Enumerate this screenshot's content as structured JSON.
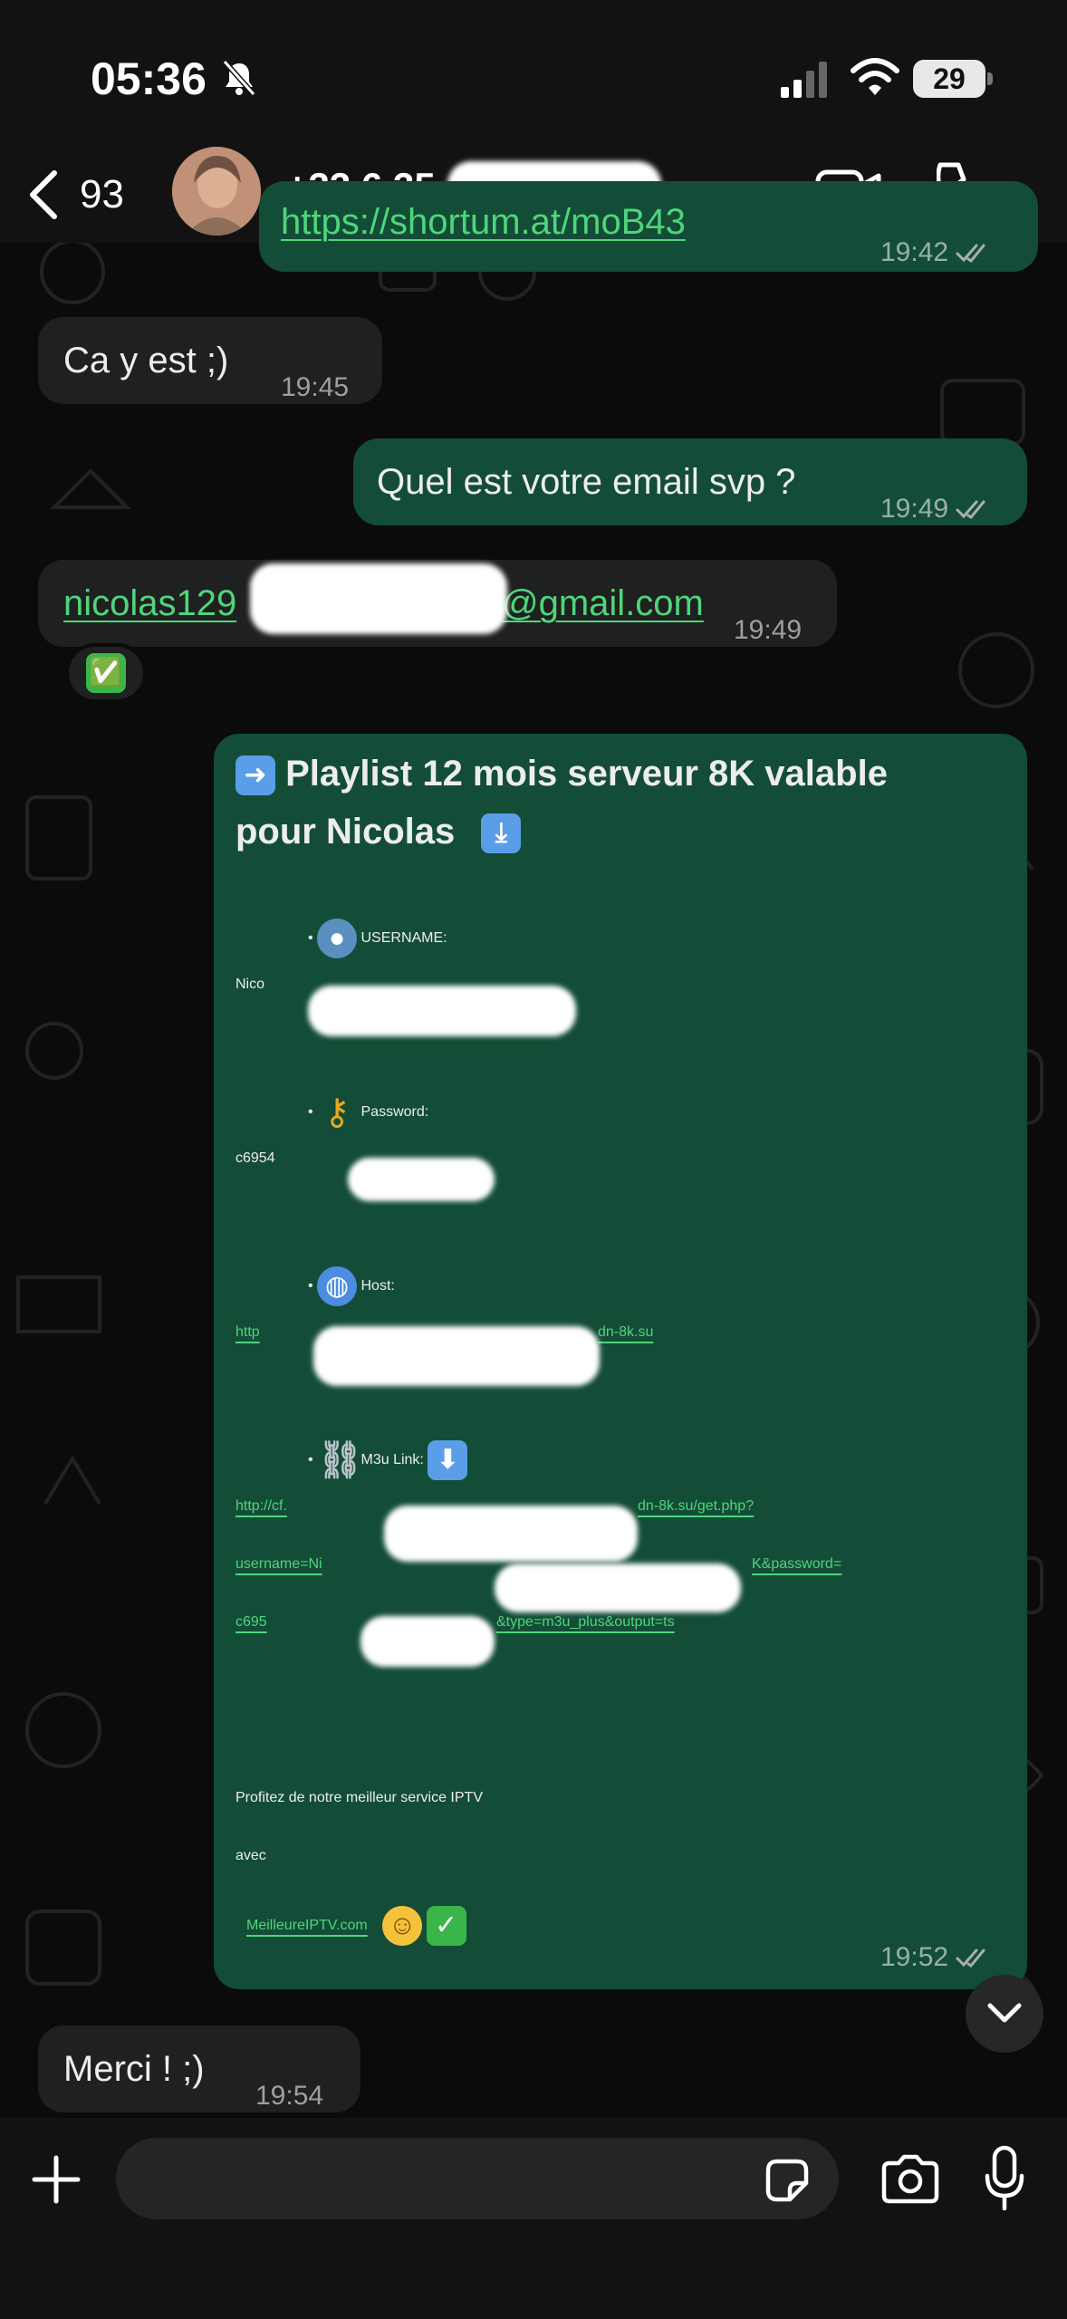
{
  "status_bar": {
    "time": "05:36",
    "battery": "29"
  },
  "header": {
    "back_count": "93",
    "contact_name": "+33 6 35"
  },
  "messages": [
    {
      "dir": "out",
      "text": "https://shortum.at/moB43",
      "time": "19:42"
    },
    {
      "dir": "in",
      "text": "Ca y est ;)",
      "time": "19:45"
    },
    {
      "dir": "out",
      "text": "Quel est votre email svp ?",
      "time": "19:49"
    },
    {
      "dir": "in",
      "text_start": "nicolas129",
      "text_end": "@gmail.com",
      "time": "19:49",
      "reaction": "✅"
    },
    {
      "dir": "out",
      "title_line1": "Playlist 12 mois serveur 8K valable",
      "title_line2": "pour Nicolas",
      "username_label": "USERNAME:",
      "username_value": "Nico",
      "password_label": "Password:",
      "password_value": "c6954",
      "host_label": "Host:",
      "host_start": "http",
      "host_end": "dn-8k.su",
      "m3u_label": "M3u Link:",
      "m3u_line1_start": "http://cf.",
      "m3u_line1_end": "dn-8k.su/get.php?",
      "m3u_line2_start": "username=Ni",
      "m3u_line2_end": "K&password=",
      "m3u_line3_start": "c695",
      "m3u_line3_end": "&type=m3u_plus&output=ts",
      "promo_line1": "Profitez de notre meilleur service IPTV",
      "promo_line2": "avec",
      "promo_link": "MeilleureIPTV.com",
      "time": "19:52"
    },
    {
      "dir": "in",
      "text": "Merci ! ;)",
      "time": "19:54"
    }
  ],
  "composer": {
    "placeholder": ""
  },
  "icons": [
    "back-chevron",
    "avatar",
    "video-call",
    "phone",
    "plus",
    "sticker",
    "camera",
    "microphone",
    "scroll-down-chevron"
  ],
  "colors": {
    "incoming_bubble": "#1f2020",
    "outgoing_bubble": "#134d37",
    "link": "#4fd57b"
  }
}
